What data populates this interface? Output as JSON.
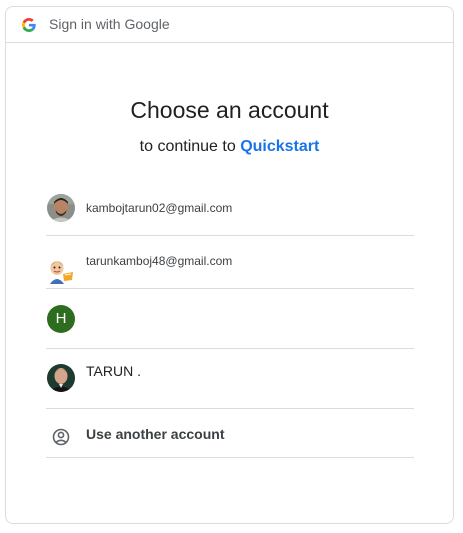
{
  "topbar": {
    "title": "Sign in with Google",
    "logo_icon": "google-g-icon"
  },
  "heading": "Choose an account",
  "subheading": {
    "prefix": "to continue to ",
    "app_name": "Quickstart"
  },
  "accounts": [
    {
      "label": "kambojtarun02@gmail.com",
      "avatar": "photo-avatar"
    },
    {
      "label": "tarunkamboj48@gmail.com",
      "avatar": "cartoon-avatar"
    },
    {
      "label": "",
      "avatar_letter": "H",
      "avatar_color": "#2e6d1f"
    },
    {
      "label": "TARUN .",
      "avatar": "photo-avatar"
    }
  ],
  "use_another": {
    "label": "Use another account",
    "icon": "person-circle-icon"
  },
  "colors": {
    "link": "#1a73e8",
    "divider": "#dadce0",
    "text": "#202124"
  }
}
